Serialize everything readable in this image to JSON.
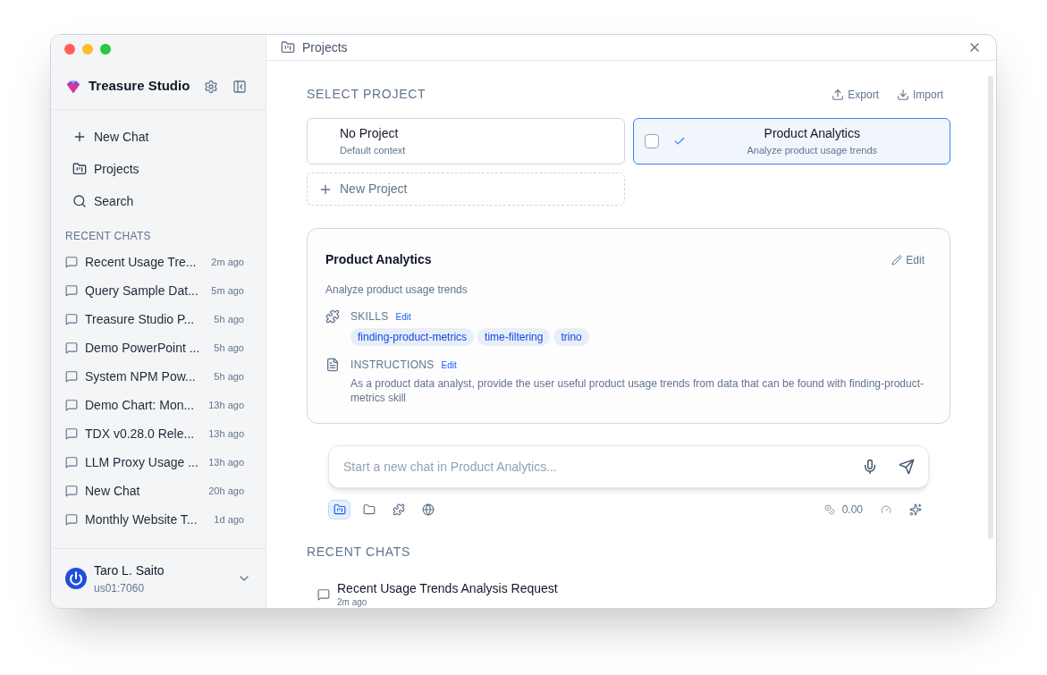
{
  "sidebar": {
    "brand": "Treasure Studio",
    "nav": [
      {
        "kind": "new",
        "label": "New Chat"
      },
      {
        "kind": "projects",
        "label": "Projects"
      },
      {
        "kind": "search",
        "label": "Search"
      }
    ],
    "recent_heading": "RECENT CHATS",
    "chats": [
      {
        "title": "Recent Usage Tre...",
        "time": "2m ago"
      },
      {
        "title": "Query Sample Dat...",
        "time": "5m ago"
      },
      {
        "title": "Treasure Studio P...",
        "time": "5h ago"
      },
      {
        "title": "Demo PowerPoint ...",
        "time": "5h ago"
      },
      {
        "title": "System NPM Pow...",
        "time": "5h ago"
      },
      {
        "title": "Demo Chart: Mon...",
        "time": "13h ago"
      },
      {
        "title": "TDX v0.28.0 Rele...",
        "time": "13h ago"
      },
      {
        "title": "LLM Proxy Usage ...",
        "time": "13h ago"
      },
      {
        "title": "New Chat",
        "time": "20h ago"
      },
      {
        "title": "Monthly Website T...",
        "time": "1d ago"
      }
    ],
    "user": {
      "name": "Taro L. Saito",
      "account": "us01:7060"
    }
  },
  "header": {
    "title": "Projects"
  },
  "select": {
    "heading": "SELECT PROJECT",
    "export": "Export",
    "import": "Import",
    "projects": [
      {
        "name": "No Project",
        "description": "Default context",
        "selected": false
      },
      {
        "name": "Product Analytics",
        "description": "Analyze product usage trends",
        "selected": true,
        "checked": false
      }
    ],
    "new_project": "New Project"
  },
  "detail": {
    "name": "Product Analytics",
    "edit": "Edit",
    "description": "Analyze product usage trends",
    "skills_label": "SKILLS",
    "skills_edit": "Edit",
    "skills": [
      "finding-product-metrics",
      "time-filtering",
      "trino"
    ],
    "instructions_label": "INSTRUCTIONS",
    "instructions_edit": "Edit",
    "instructions": "As a product data analyst, provide the user useful product usage trends from data that can be found with finding-product-metrics skill"
  },
  "composer": {
    "placeholder": "Start a new chat in Product Analytics...",
    "tools": [
      {
        "kind": "project",
        "selected": true
      },
      {
        "kind": "folder",
        "selected": false
      },
      {
        "kind": "skills",
        "selected": false
      },
      {
        "kind": "web",
        "selected": false
      }
    ],
    "cost": "0.00"
  },
  "recent": {
    "heading": "RECENT CHATS",
    "chats": [
      {
        "title": "Recent Usage Trends Analysis Request",
        "time": "2m ago"
      }
    ]
  }
}
